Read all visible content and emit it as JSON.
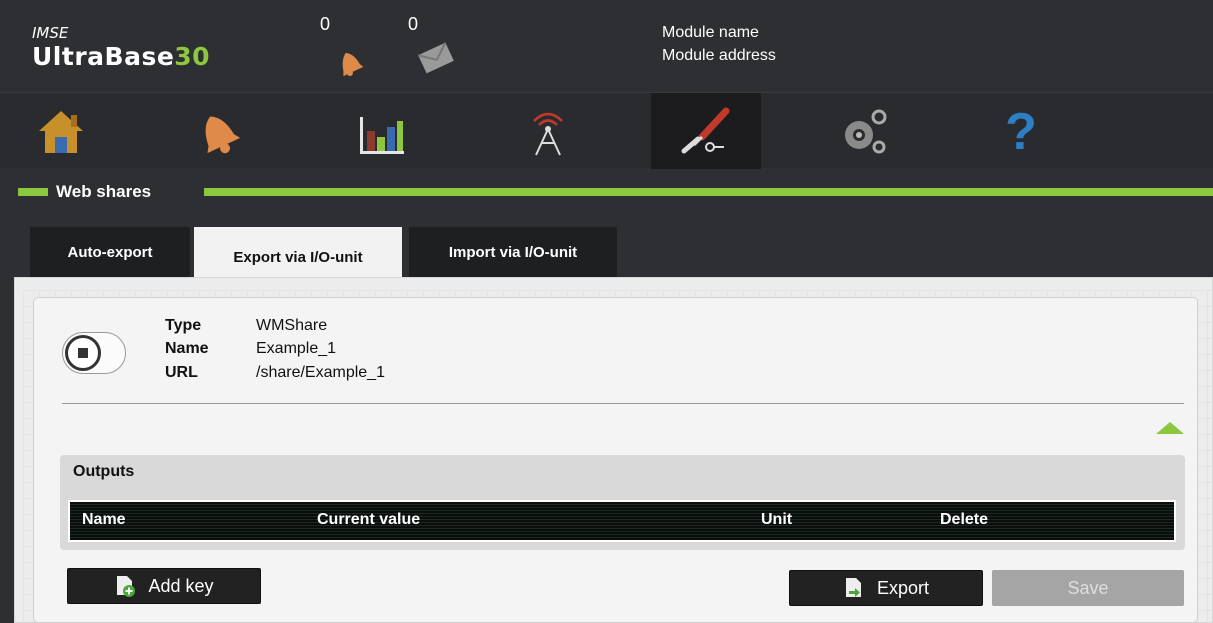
{
  "header": {
    "brand_top": "IMSE",
    "brand_main": "UltraBase",
    "brand_accent": "30",
    "alarm_count": "0",
    "message_count": "0",
    "module_name": "Module name",
    "module_address": "Module address"
  },
  "nav": {
    "items": [
      {
        "icon": "home-icon"
      },
      {
        "icon": "bell-icon"
      },
      {
        "icon": "chart-icon"
      },
      {
        "icon": "antenna-icon"
      },
      {
        "icon": "tools-icon",
        "active": true
      },
      {
        "icon": "gears-icon"
      },
      {
        "icon": "help-icon"
      }
    ]
  },
  "section": {
    "title": "Web shares"
  },
  "tabs": [
    {
      "label": "Auto-export"
    },
    {
      "label": "Export via I/O-unit",
      "active": true
    },
    {
      "label": "Import via I/O-unit"
    }
  ],
  "share": {
    "type_label": "Type",
    "type_value": "WMShare",
    "name_label": "Name",
    "name_value": "Example_1",
    "url_label": "URL",
    "url_value": "/share/Example_1"
  },
  "outputs": {
    "title": "Outputs",
    "columns": [
      "Name",
      "Current value",
      "Unit",
      "Delete"
    ]
  },
  "buttons": {
    "add_key": "Add key",
    "export": "Export",
    "save": "Save"
  },
  "colors": {
    "accent": "#8dc63f",
    "background": "#2e2f33",
    "panel": "#ececec"
  }
}
